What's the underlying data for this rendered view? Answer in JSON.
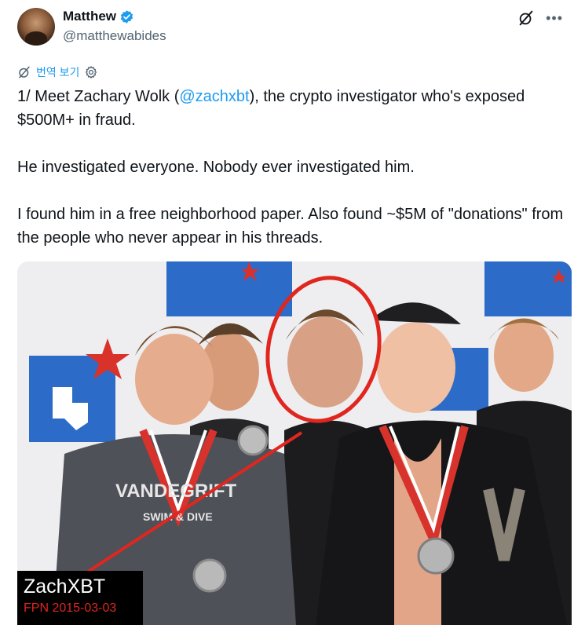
{
  "author": {
    "name": "Matthew",
    "handle": "@matthewabides"
  },
  "translate": {
    "label": "번역 보기"
  },
  "tweet": {
    "line1_prefix": "1/ Meet Zachary Wolk (",
    "line1_mention": "@zachxbt",
    "line1_suffix": "), the crypto investigator who's exposed $500M+ in fraud.",
    "line2": "He investigated everyone. Nobody ever investigated him.",
    "line3": "I found him in a free neighborhood paper. Also found ~$5M of \"donations\" from the people who never appear in his threads."
  },
  "media": {
    "caption_title": "ZachXBT",
    "caption_sub": "FPN 2015-03-03",
    "jacket_text_1": "VANDEGRIFT",
    "jacket_text_2": "SWIM & DIVE",
    "colors": {
      "highlight_circle": "#e0261f",
      "banner_blue": "#2d6bc9",
      "banner_red": "#d9322b"
    }
  },
  "icons": {
    "verified": "verified-badge-icon",
    "grok": "grok-icon",
    "more": "more-icon",
    "translate": "translate-icon",
    "settings": "gear-icon"
  }
}
